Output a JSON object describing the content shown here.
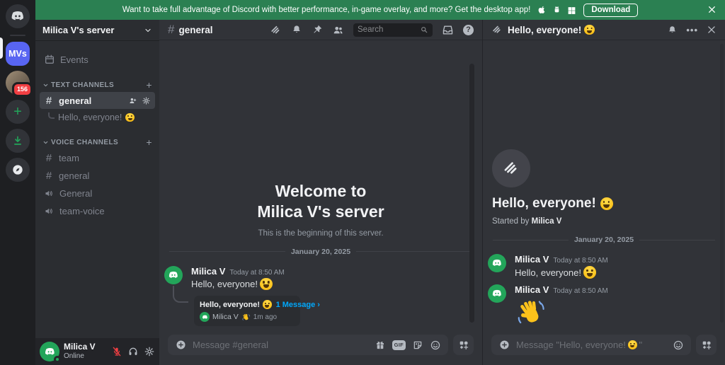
{
  "icons": {
    "add": "+",
    "help": "?",
    "more": "•••",
    "link_chevron": "›",
    "gif": "GIF"
  },
  "banner": {
    "message": "Want to take full advantage of Discord with better performance, in-game overlay, and more? Get the desktop app!",
    "download_label": "Download",
    "color": "#2b8052"
  },
  "rail": {
    "server_initials": "MVs",
    "mention_badge": "156"
  },
  "sidebar": {
    "server_name": "Milica V's server",
    "events_label": "Events",
    "text_channels_label": "TEXT CHANNELS",
    "voice_channels_label": "VOICE CHANNELS",
    "selected_channel": "general",
    "thread_item": {
      "text": "Hello, everyone!"
    },
    "voice_items": [
      {
        "name": "team"
      },
      {
        "name": "general"
      },
      {
        "name": "General"
      },
      {
        "name": "team-voice"
      }
    ],
    "user": {
      "name": "Milica V",
      "status": "Online"
    }
  },
  "chat": {
    "channel_name": "general",
    "search_placeholder": "Search",
    "welcome_title_line1": "Welcome to",
    "welcome_title_line2": "Milica V's server",
    "welcome_subtitle": "This is the beginning of this server.",
    "date_divider": "January 20, 2025",
    "message": {
      "author": "Milica V",
      "timestamp": "Today at 8:50 AM",
      "text": "Hello, everyone!"
    },
    "thread_card": {
      "title": "Hello, everyone!",
      "link_label": "1 Message",
      "author": "Milica V",
      "time": "1m ago"
    },
    "composer_placeholder": "Message #general"
  },
  "thread": {
    "header_title": "Hello, everyone!",
    "title": "Hello, everyone!",
    "started_by_label": "Started by",
    "starter_name": "Milica V",
    "date_divider": "January 20, 2025",
    "message1": {
      "author": "Milica V",
      "timestamp": "Today at 8:50 AM",
      "text": "Hello, everyone!"
    },
    "message2": {
      "author": "Milica V",
      "timestamp": "Today at 8:50 AM"
    },
    "composer_placeholder_prefix": "Message \"Hello, everyone!",
    "composer_placeholder_suffix": "\""
  },
  "accent_colors": {
    "brand_blue": "#5865f2",
    "green": "#23a55a",
    "red": "#f23f43",
    "link": "#00a8fc"
  }
}
